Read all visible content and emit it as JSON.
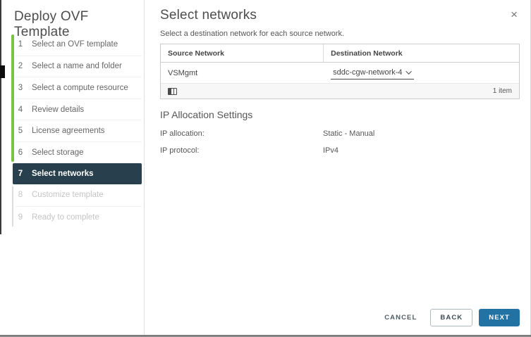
{
  "colors": {
    "accent_green": "#7cc242",
    "active_step_bg": "#28404d",
    "primary_button_blue": "#2272a3"
  },
  "sidebar": {
    "title": "Deploy OVF Template",
    "steps": [
      {
        "num": "1",
        "label": "Select an OVF template",
        "state": "done"
      },
      {
        "num": "2",
        "label": "Select a name and folder",
        "state": "done"
      },
      {
        "num": "3",
        "label": "Select a compute resource",
        "state": "done"
      },
      {
        "num": "4",
        "label": "Review details",
        "state": "done"
      },
      {
        "num": "5",
        "label": "License agreements",
        "state": "done"
      },
      {
        "num": "6",
        "label": "Select storage",
        "state": "done"
      },
      {
        "num": "7",
        "label": "Select networks",
        "state": "active"
      },
      {
        "num": "8",
        "label": "Customize template",
        "state": "disabled"
      },
      {
        "num": "9",
        "label": "Ready to complete",
        "state": "disabled"
      }
    ]
  },
  "header": {
    "title": "Select networks",
    "subtitle": "Select a destination network for each source network.",
    "close_label": "×"
  },
  "network_table": {
    "columns": {
      "source": "Source Network",
      "destination": "Destination Network"
    },
    "rows": [
      {
        "source": "VSMgmt",
        "destination_selected": "sddc-cgw-network-4"
      }
    ],
    "footer": {
      "item_count": "1 item",
      "icon": "column-toggle-icon"
    }
  },
  "ip_allocation": {
    "heading": "IP Allocation Settings",
    "fields": [
      {
        "label": "IP allocation:",
        "value": "Static - Manual"
      },
      {
        "label": "IP protocol:",
        "value": "IPv4"
      }
    ]
  },
  "footer_buttons": {
    "cancel": "CANCEL",
    "back": "BACK",
    "next": "NEXT"
  }
}
